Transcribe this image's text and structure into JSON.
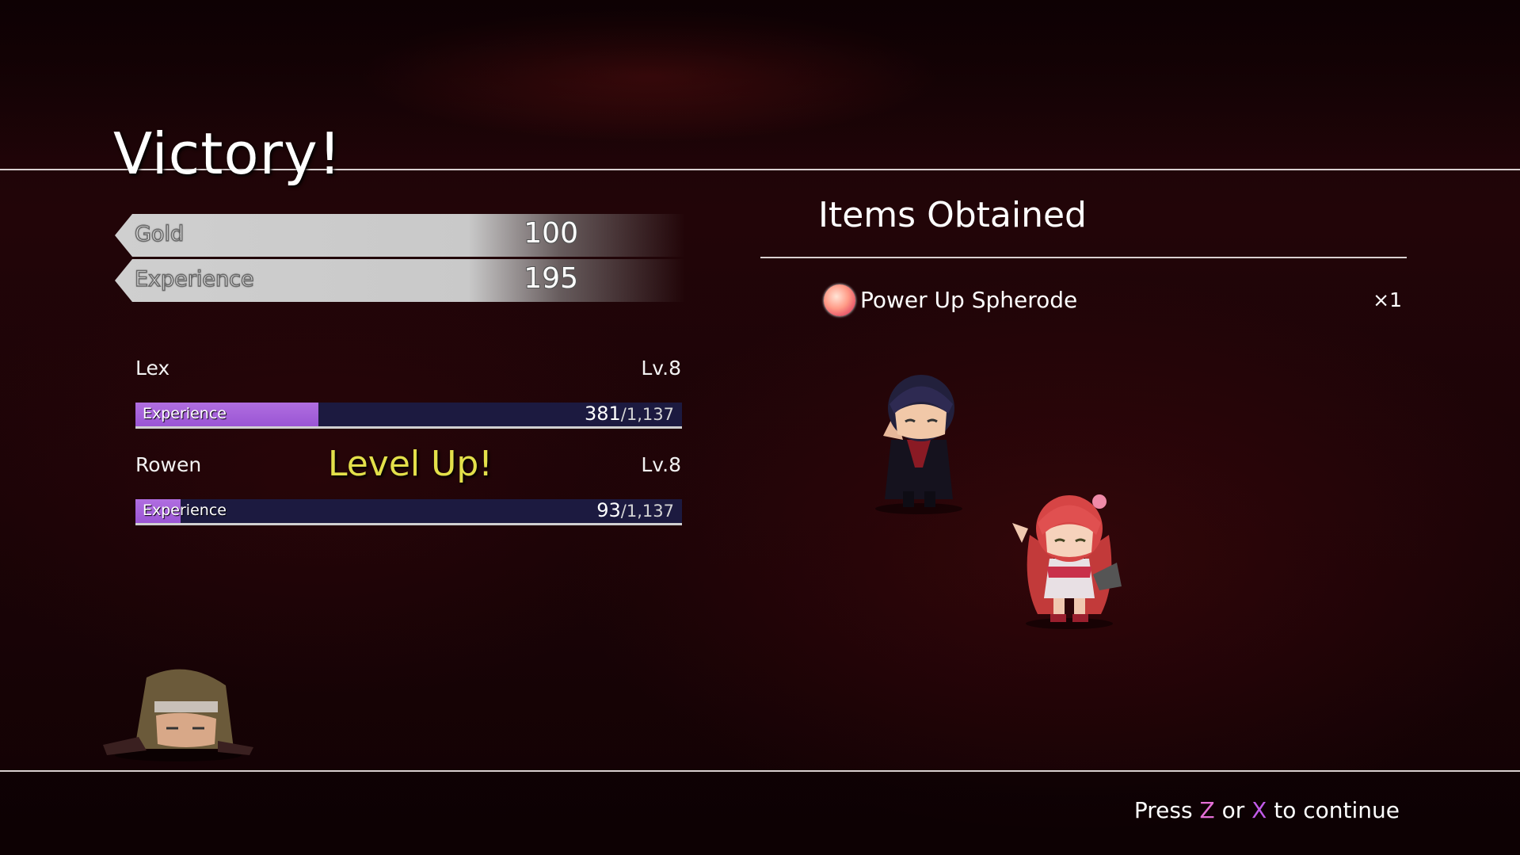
{
  "title": "Victory!",
  "rewards": {
    "gold": {
      "label": "Gold",
      "value": "100"
    },
    "experience": {
      "label": "Experience",
      "value": "195"
    }
  },
  "party": [
    {
      "name": "Lex",
      "level": "Lv.8",
      "exp_label": "Experience",
      "exp_current": "381",
      "exp_max": "/1,137",
      "exp_fraction": 0.335
    },
    {
      "name": "Rowen",
      "level": "Lv.8",
      "exp_label": "Experience",
      "exp_current": "93",
      "exp_max": "/1,137",
      "exp_fraction": 0.082,
      "status": "Level Up!"
    }
  ],
  "items": {
    "title": "Items Obtained",
    "list": [
      {
        "name": "Power Up Spherode",
        "quantity": "×1",
        "icon": "spherode-orb-icon"
      }
    ]
  },
  "prompt": {
    "press": "Press",
    "key1": "Z",
    "or": "or",
    "key2": "X",
    "rest": "to continue"
  },
  "colors": {
    "accent_level_up": "#e3e04a",
    "exp_fill": "#a462da",
    "exp_track": "#1c1a40",
    "key_z": "#e46fd6",
    "key_x": "#c25bea"
  }
}
